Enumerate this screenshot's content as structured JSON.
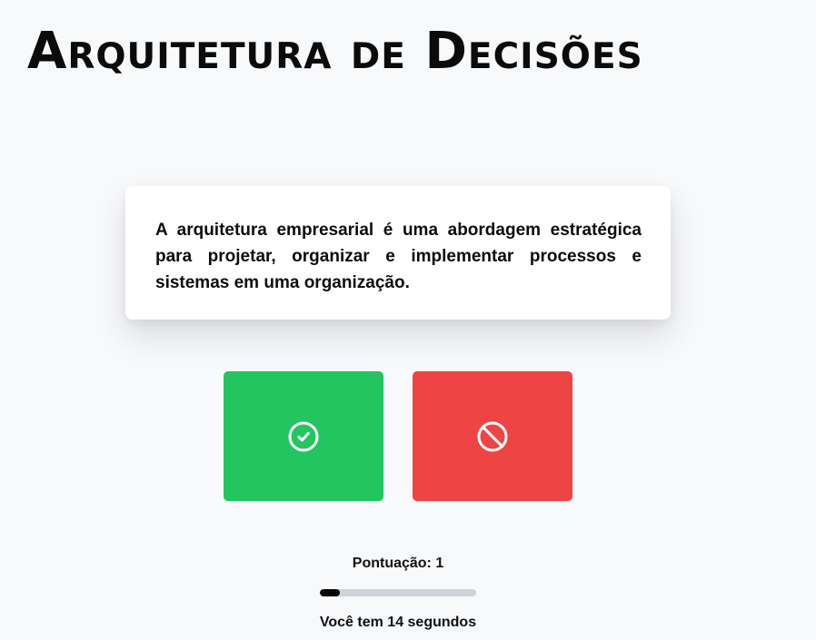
{
  "app": {
    "title": "Arquitetura de Decisões"
  },
  "question": {
    "text": "A arquitetura empresarial é uma abordagem estratégica para projetar, organizar e implementar processos e sistemas em uma organização."
  },
  "buttons": {
    "true_icon": "check-circle-icon",
    "false_icon": "ban-icon",
    "true_color": "#22c55e",
    "false_color": "#ef4444"
  },
  "status": {
    "score_text": "Pontuação: 1",
    "timer_text": "Você tem 14 segundos",
    "progress_fraction": 0.13
  }
}
